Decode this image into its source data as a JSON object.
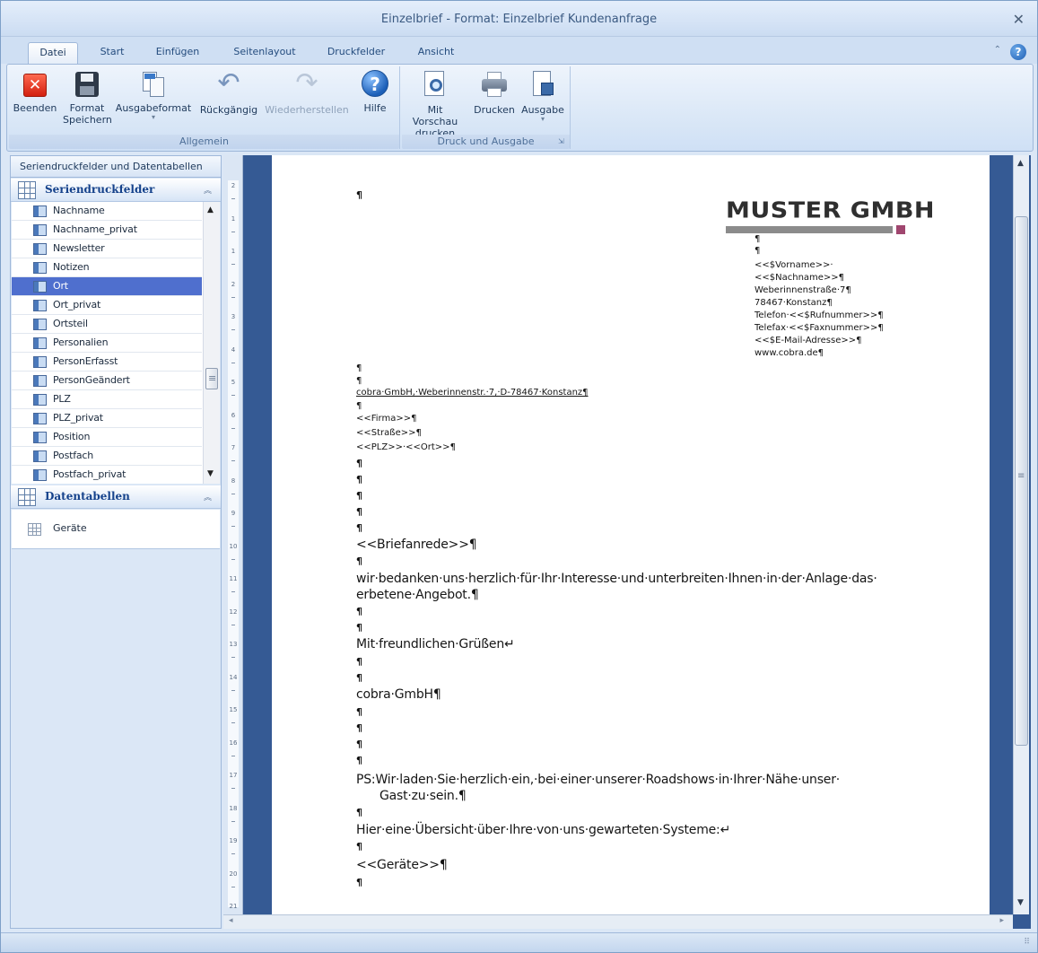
{
  "window": {
    "title": "Einzelbrief - Format: Einzelbrief Kundenanfrage"
  },
  "tabs": [
    {
      "label": "Datei",
      "active": true
    },
    {
      "label": "Start"
    },
    {
      "label": "Einfügen"
    },
    {
      "label": "Seitenlayout"
    },
    {
      "label": "Druckfelder"
    },
    {
      "label": "Ansicht"
    }
  ],
  "ribbon": {
    "groups": [
      {
        "label": "Allgemein"
      },
      {
        "label": "Druck und Ausgabe"
      }
    ],
    "buttons": {
      "beenden": {
        "line1": "Beenden",
        "line2": ""
      },
      "format_speichern": {
        "line1": "Format",
        "line2": "Speichern"
      },
      "ausgabeformat": {
        "line1": "Ausgabeformat",
        "line2": "▾"
      },
      "rueckgaengig": {
        "line1": "Rückgängig",
        "line2": ""
      },
      "wiederherstellen": {
        "line1": "Wiederherstellen",
        "line2": ""
      },
      "hilfe": {
        "line1": "Hilfe",
        "line2": ""
      },
      "vorschau": {
        "line1": "Mit Vorschau",
        "line2": "drucken"
      },
      "drucken": {
        "line1": "Drucken",
        "line2": ""
      },
      "ausgabe": {
        "line1": "Ausgabe",
        "line2": "▾"
      }
    }
  },
  "left_panel": {
    "title": "Seriendruckfelder und Datentabellen",
    "fields_section": "Seriendruckfelder",
    "fields": [
      "Nachname",
      "Nachname_privat",
      "Newsletter",
      "Notizen",
      "Ort",
      "Ort_privat",
      "Ortsteil",
      "Personalien",
      "PersonErfasst",
      "PersonGeändert",
      "PLZ",
      "PLZ_privat",
      "Position",
      "Postfach",
      "Postfach_privat"
    ],
    "selected_field": "Ort",
    "tables_section": "Datentabellen",
    "tables": [
      "Geräte"
    ]
  },
  "ruler": {
    "numbers": [
      "2",
      "1",
      "1",
      "2",
      "3",
      "4",
      "5",
      "6",
      "7",
      "8",
      "9",
      "10",
      "11",
      "12",
      "13",
      "14",
      "15",
      "16",
      "17",
      "18",
      "19",
      "20",
      "21"
    ]
  },
  "document": {
    "logo": "MUSTER GMBH",
    "sender_block": [
      "¶",
      "¶",
      "<<$Vorname>>·",
      "<<$Nachname>>¶",
      "Weberinnenstraße·7¶",
      "78467·Konstanz¶",
      "Telefon·<<$Rufnummer>>¶",
      "Telefax·<<$Faxnummer>>¶",
      "<<$E-Mail-Adresse>>¶",
      "www.cobra.de¶"
    ],
    "return_address": "cobra·GmbH,·Weberinnenstr.·7,·D-78467·Konstanz¶",
    "recipient": [
      "<<Firma>>¶",
      "<<Straße>>¶",
      "<<PLZ>>·<<Ort>>¶"
    ],
    "salutation": "<<Briefanrede>>¶",
    "body_line1": "wir·bedanken·uns·herzlich·für·Ihr·Interesse·und·unterbreiten·Ihnen·in·der·Anlage·das·",
    "body_line2": "erbetene·Angebot.¶",
    "closing": "Mit·freundlichen·Grüßen↵",
    "company": "cobra·GmbH¶",
    "ps_line1": "PS:Wir·laden·Sie·herzlich·ein,·bei·einer·unserer·Roadshows·in·Ihrer·Nähe·unser·",
    "ps_line2": "Gast·zu·sein.¶",
    "overview": "Hier·eine·Übersicht·über·Ihre·von·uns·gewarteten·Systeme:↵",
    "geraete": "<<Geräte>>¶",
    "pilcrow": "¶"
  }
}
